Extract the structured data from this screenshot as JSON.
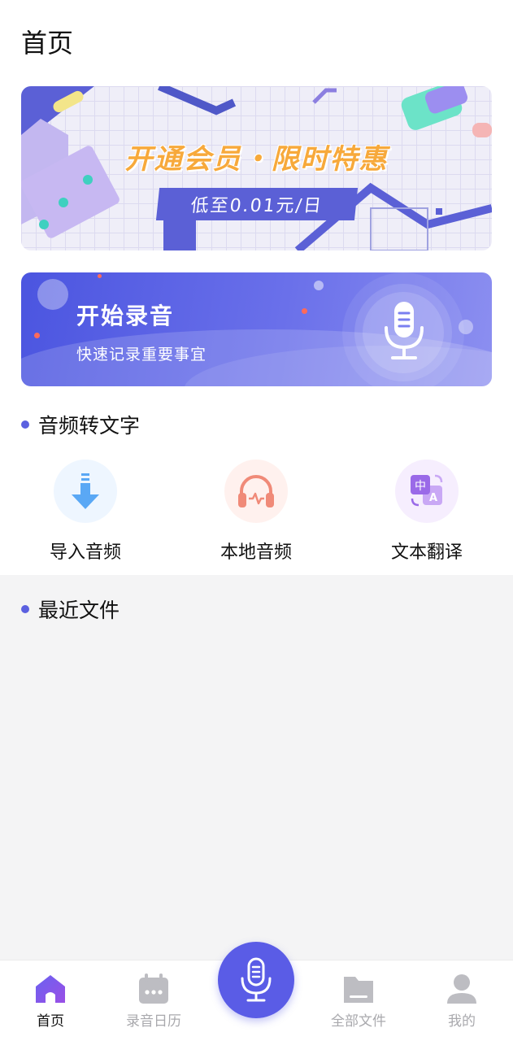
{
  "header": {
    "title": "首页"
  },
  "promo": {
    "title": "开通会员・限时特惠",
    "subtitle": "低至0.01元/日"
  },
  "record_banner": {
    "title": "开始录音",
    "subtitle": "快速记录重要事宜",
    "icon": "microphone-icon"
  },
  "audio_section": {
    "title": "音频转文字",
    "features": [
      {
        "label": "导入音频",
        "icon": "import-download-icon",
        "color": "#5aa8f5"
      },
      {
        "label": "本地音频",
        "icon": "headphones-icon",
        "color": "#f08a78"
      },
      {
        "label": "文本翻译",
        "icon": "translate-icon",
        "color": "#9a6ae8"
      }
    ]
  },
  "recent_section": {
    "title": "最近文件"
  },
  "tabbar": {
    "items": [
      {
        "label": "首页",
        "icon": "home-icon",
        "active": true
      },
      {
        "label": "录音日历",
        "icon": "calendar-icon",
        "active": false
      },
      {
        "label": "全部文件",
        "icon": "folder-icon",
        "active": false
      },
      {
        "label": "我的",
        "icon": "user-icon",
        "active": false
      }
    ],
    "center_icon": "microphone-icon"
  },
  "colors": {
    "accent": "#5a5ce6",
    "promo_title": "#f7a93b",
    "inactive_tab": "#a9a9ad"
  }
}
